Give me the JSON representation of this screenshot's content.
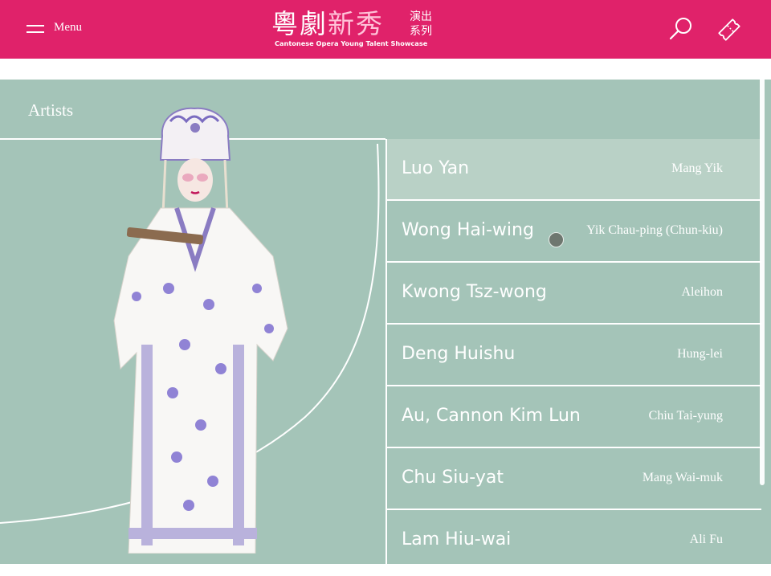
{
  "header": {
    "menu_label": "Menu",
    "logo_white": "粵劇",
    "logo_pink": "新秀",
    "logo_side": "演出系列",
    "logo_subtitle": "Cantonese Opera Young Talent Showcase",
    "accent_color": "#e0226a",
    "icons": [
      "menu-icon",
      "search-icon",
      "ticket-icon"
    ]
  },
  "section": {
    "title": "Artists",
    "background_color": "#a4c4b8"
  },
  "artists": [
    {
      "name": "Luo Yan",
      "role": "Mang Yik",
      "active": true
    },
    {
      "name": "Wong Hai-wing",
      "role": "Yik Chau-ping (Chun-kiu)",
      "active": false
    },
    {
      "name": "Kwong Tsz-wong",
      "role": "Aleihon",
      "active": false
    },
    {
      "name": "Deng Huishu",
      "role": "Hung-lei",
      "active": false
    },
    {
      "name": "Au, Cannon Kim Lun",
      "role": "Chiu Tai-yung",
      "active": false
    },
    {
      "name": "Chu Siu-yat",
      "role": "Mang Wai-muk",
      "active": false
    },
    {
      "name": "Lam Hiu-wai",
      "role": "Ali Fu",
      "active": false
    }
  ]
}
